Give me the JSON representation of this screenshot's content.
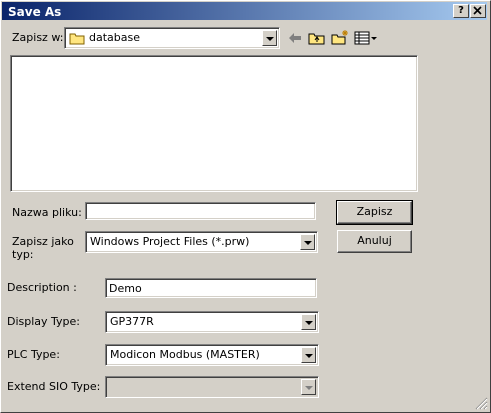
{
  "window": {
    "title": "Save As",
    "help_label": "?",
    "close_label": "X"
  },
  "location": {
    "label": "Zapisz w:",
    "value": "database"
  },
  "toolbar": {
    "back_icon": "back-arrow-icon",
    "up_icon": "up-folder-icon",
    "new_folder_icon": "new-folder-icon",
    "views_icon": "views-menu-icon"
  },
  "file_list": [],
  "filename": {
    "label": "Nazwa pliku:",
    "value": ""
  },
  "filetype": {
    "label_line1": "Zapisz jako",
    "label_line2": "typ:",
    "value": "Windows Project Files (*.prw)"
  },
  "buttons": {
    "save": "Zapisz",
    "cancel": "Anuluj"
  },
  "description": {
    "label": "Description :",
    "value": "Demo"
  },
  "display_type": {
    "label": "Display Type:",
    "value": "GP377R"
  },
  "plc_type": {
    "label": "PLC Type:",
    "value": "Modicon Modbus (MASTER)"
  },
  "extend_sio": {
    "label": "Extend SIO Type:",
    "value": ""
  },
  "colors": {
    "title_start": "#0a246a",
    "title_end": "#a6caf0",
    "face": "#d4d0c8"
  }
}
